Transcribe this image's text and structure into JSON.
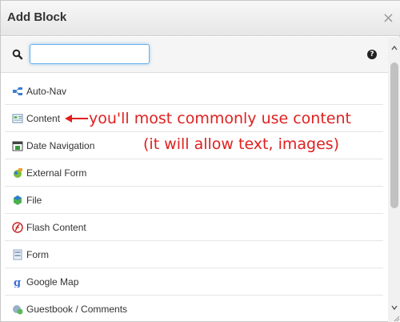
{
  "dialog": {
    "title": "Add Block",
    "close_symbol": "×"
  },
  "search": {
    "value": "",
    "placeholder": "",
    "help_symbol": "?"
  },
  "blocks": [
    {
      "label": "Auto-Nav",
      "icon": "auto-nav-icon"
    },
    {
      "label": "Content",
      "icon": "content-icon"
    },
    {
      "label": "Date Navigation",
      "icon": "date-navigation-icon"
    },
    {
      "label": "External Form",
      "icon": "external-form-icon"
    },
    {
      "label": "File",
      "icon": "file-icon"
    },
    {
      "label": "Flash Content",
      "icon": "flash-content-icon"
    },
    {
      "label": "Form",
      "icon": "form-icon"
    },
    {
      "label": "Google Map",
      "icon": "google-map-icon"
    },
    {
      "label": "Guestbook / Comments",
      "icon": "guestbook-icon"
    }
  ],
  "annotation": {
    "line1": "you'll most commonly use content",
    "line2": "(it will allow text, images)",
    "color": "#e02020"
  }
}
